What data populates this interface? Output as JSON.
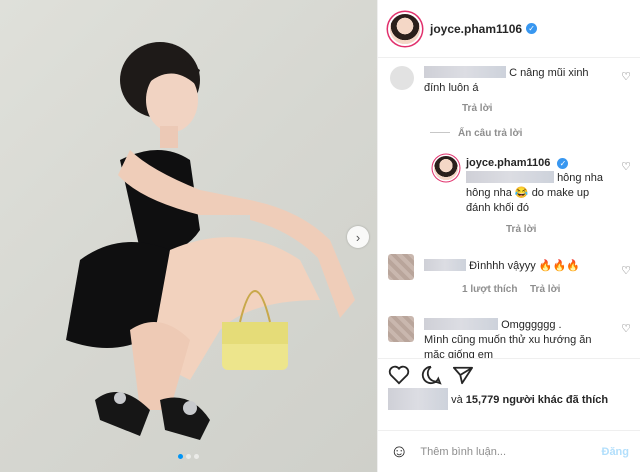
{
  "header": {
    "username": "joyce.pham1106"
  },
  "comments": [
    {
      "text_suffix": "C nâng mũi xinh",
      "text_line2": "đính luôn á",
      "reply_label": "Trả lời"
    },
    {
      "toggle": "Ẩn câu trả lời"
    },
    {
      "username": "joyce.pham1106",
      "text_part1": "hông nha",
      "text_line2": "hông nha 😂 do make up",
      "text_line3": "đánh khối đó",
      "reply_label": "Trả lời"
    },
    {
      "text": "Đìnhhh vậyyy 🔥🔥🔥",
      "likes_label": "1 lượt thích",
      "reply_label": "Trả lời"
    },
    {
      "text": "Omgggggg .",
      "text_line2": "Mình cũng muốn thử xu hướng ăn",
      "text_line3": "mặc giống em"
    }
  ],
  "likes": {
    "count_text": "15,779",
    "middle": "và",
    "suffix": "người khác đã thích"
  },
  "comment_input": {
    "placeholder": "Thêm bình luận...",
    "post_label": "Đăng"
  },
  "icons": {
    "heart": "heart-icon",
    "comment": "comment-icon",
    "share": "share-icon",
    "emoji": "emoji-icon",
    "next": "chevron-right-icon"
  }
}
